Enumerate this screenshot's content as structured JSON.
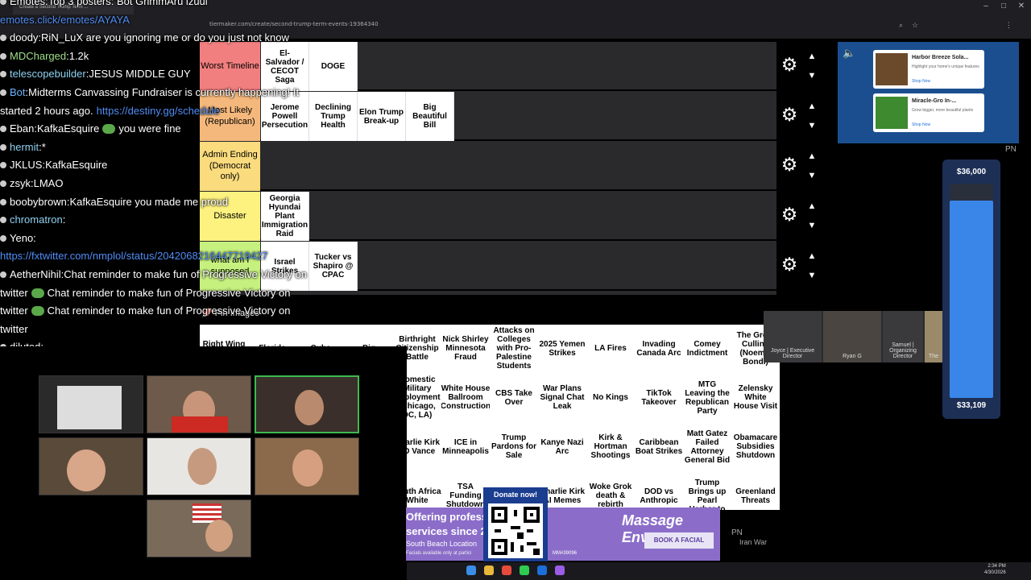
{
  "browser": {
    "tab_title": "Create a Second Trump Term ...",
    "url": "tiermaker.com/create/second-trump-term-events-19364340"
  },
  "tiers": [
    {
      "label": "Worst Timeline",
      "color": "#f27f7f",
      "items": [
        "El-Salvador / CECOT Saga",
        "DOGE"
      ]
    },
    {
      "label": "Most Likely (Republican)",
      "color": "#f5b87c",
      "items": [
        "Jerome Powell Persecution",
        "Declining Trump Health",
        "Elon Trump Break-up",
        "Big Beautiful Bill"
      ]
    },
    {
      "label": "Admin Ending (Democrat only)",
      "color": "#fadb7d",
      "items": []
    },
    {
      "label": "Disaster",
      "color": "#fdf27f",
      "items": [
        "Georgia Hyundai Plant Immigration Raid"
      ]
    },
    {
      "label": "what am I supposed",
      "color": "#c7f17f",
      "items": [
        "Israel Strikes",
        "Tucker vs Shapiro @ CPAC"
      ]
    }
  ],
  "pin_images_label": "Pin Images",
  "unsorted": [
    [
      "Right Wing Attacks on",
      "Florida",
      "Cuba",
      "Big",
      "Birthright Citizenship Battle",
      "Nick Shirley Minnesota Fraud",
      "Attacks on Colleges with Pro-Palestine Students",
      "2025 Yemen Strikes",
      "LA Fires",
      "Invading Canada Arc",
      "Comey Indictment",
      "The Great Culling (Noem's Bondi)"
    ],
    [
      "Domestic Military Deployment (Chicago, DC, LA)",
      "White House Ballroom Construction",
      "CBS Take Over",
      "War Plans Signal Chat Leak",
      "No Kings",
      "TikTok Takeover",
      "MTG Leaving the Republican Party",
      "Zelensky White House Visit"
    ],
    [
      "Charlie Kirk JD Vance",
      "ICE in Minneapolis",
      "Trump Pardons for Sale",
      "Kanye Nazi Arc",
      "Kirk & Hortman Shootings",
      "Caribbean Boat Strikes",
      "Matt Gatez Failed Attorney General Bid",
      "Obamacare Subsidies Shutdown"
    ],
    [
      "South Africa White",
      "TSA Funding Shutdown",
      "",
      "Charlie Kirk AI Memes",
      "Woke Grok death & rebirth",
      "DOD vs Anthropic",
      "Trump Brings up Pearl Harbor to",
      "Greenland Threats"
    ]
  ],
  "chat": [
    {
      "user": "Emotes",
      "text": "Top 3 posters: Bot GrimmAru izuul",
      "user_color": "#ffffff"
    },
    {
      "user": "",
      "text": "emotes.click/emotes/AYAYA",
      "link": true
    },
    {
      "user": "doody",
      "text": "RiN_LuX are you ignoring me or do you just not know",
      "user_color": "#ffffff"
    },
    {
      "user": "MDCharged",
      "text": "1.2k",
      "user_color": "#9fe08a"
    },
    {
      "user": "telescopebuilder",
      "text": "JESUS MIDDLE GUY",
      "user_color": "#8ed1f0"
    },
    {
      "user": "Bot",
      "text": "Midterms Canvassing Fundraiser is currently happening! It",
      "user_color": "#6ab4ff"
    },
    {
      "user": "",
      "text": "started 2 hours ago.",
      "link_text": "https://destiny.gg/schedule"
    },
    {
      "user": "Eban",
      "text": "KafkaEsquire",
      "tail": "you were fine",
      "user_color": "#ffffff"
    },
    {
      "user": "hermit",
      "text": "*",
      "user_color": "#8ed1f0"
    },
    {
      "user": "JKLUS",
      "text": "KafkaEsquire",
      "user_color": "#ffffff"
    },
    {
      "user": "zsyk",
      "text": "LMAO",
      "user_color": "#ffffff"
    },
    {
      "user": "boobybrown",
      "text": "KafkaEsquire you made me proud",
      "user_color": "#ffffff"
    },
    {
      "user": "chromatron",
      "text": "",
      "user_color": "#8ed1f0"
    },
    {
      "user": "Yeno",
      "text": "",
      "user_color": "#ffffff"
    },
    {
      "user": "",
      "text": "https://fxtwitter.com/nmplol/status/2042068216447719427",
      "link": true
    },
    {
      "user": "AetherNihil",
      "text": "Chat reminder to make fun of Progressive Victory on",
      "user_color": "#ffffff"
    },
    {
      "user": "",
      "text": "twitter",
      "tail": "Chat reminder to make fun of Progressive Victory on"
    },
    {
      "user": "",
      "text": "twitter",
      "tail": "Chat reminder to make fun of Progressive Victory on"
    },
    {
      "user": "",
      "text": "twitter"
    },
    {
      "user": "diluted",
      "text": "",
      "user_color": "#ffffff"
    }
  ],
  "ad_top": {
    "cards": [
      {
        "title": "Harbor Breeze Sola...",
        "desc": "Highlight your home's unique features",
        "shop": "Shop Now"
      },
      {
        "title": "Miracle-Gro In-...",
        "desc": "Grow bigger, more beautiful plants",
        "shop": "Shop Now"
      }
    ],
    "pn": "PN"
  },
  "goal": {
    "top": "$36,000",
    "bottom": "$33,109",
    "fraction": 0.92
  },
  "video_call": [
    {
      "name": "Joyce | Executive Director"
    },
    {
      "name": "Ryan G"
    },
    {
      "name": "Samuel | Organizing Director"
    },
    {
      "name": "The"
    }
  ],
  "donate": {
    "title": "Donate now!"
  },
  "ad_bottom": {
    "line1": "Offering profess",
    "line2": "services since 2",
    "line3": "South Beach Location",
    "line4": "Facials available only at partici",
    "brand": "Massage Envy",
    "button": "BOOK A FACIAL",
    "code": "MM#39096"
  },
  "clock": {
    "time": "2:34 PM",
    "date": "4/30/2026"
  },
  "pn_bottom": "PN",
  "iran_war": "Iran War"
}
